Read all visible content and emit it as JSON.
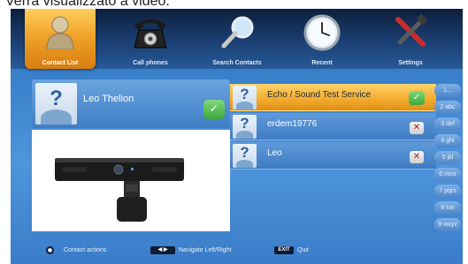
{
  "caption": "Verrà visualizzato a video:",
  "tabs": [
    {
      "label": "Contact List",
      "icon": "contact-person-icon",
      "active": true
    },
    {
      "label": "Call phones",
      "icon": "telephone-icon",
      "active": false
    },
    {
      "label": "Search Contacts",
      "icon": "magnifier-icon",
      "active": false
    },
    {
      "label": "Recent",
      "icon": "clock-icon",
      "active": false
    },
    {
      "label": "Settings",
      "icon": "tools-icon",
      "active": false
    }
  ],
  "contact_card": {
    "name": "Leo Thelion",
    "status_icon": "check-icon"
  },
  "preview": {
    "icon": "webcam-icon"
  },
  "contacts": [
    {
      "name": "Echo / Sound Test Service",
      "selected": true,
      "action_icon": "check-icon"
    },
    {
      "name": "erdem19776",
      "selected": false,
      "action_icon": "close-icon"
    },
    {
      "name": "Leo",
      "selected": false,
      "action_icon": "close-icon"
    }
  ],
  "keypad": [
    "1...",
    "2 abc",
    "3 def",
    "4 ghi",
    "5 jkl",
    "6 mno",
    "7 pqrs",
    "8 tuv",
    "9 wxyz"
  ],
  "bottom": {
    "contact_actions": "Contact actions",
    "navigate": "Navigate Left/Right",
    "exit_key": "EXIT",
    "quit": "Quit"
  },
  "colors": {
    "accent": "#f0a32a",
    "background": "#3b82cc",
    "topbar": "#1b3f73"
  }
}
